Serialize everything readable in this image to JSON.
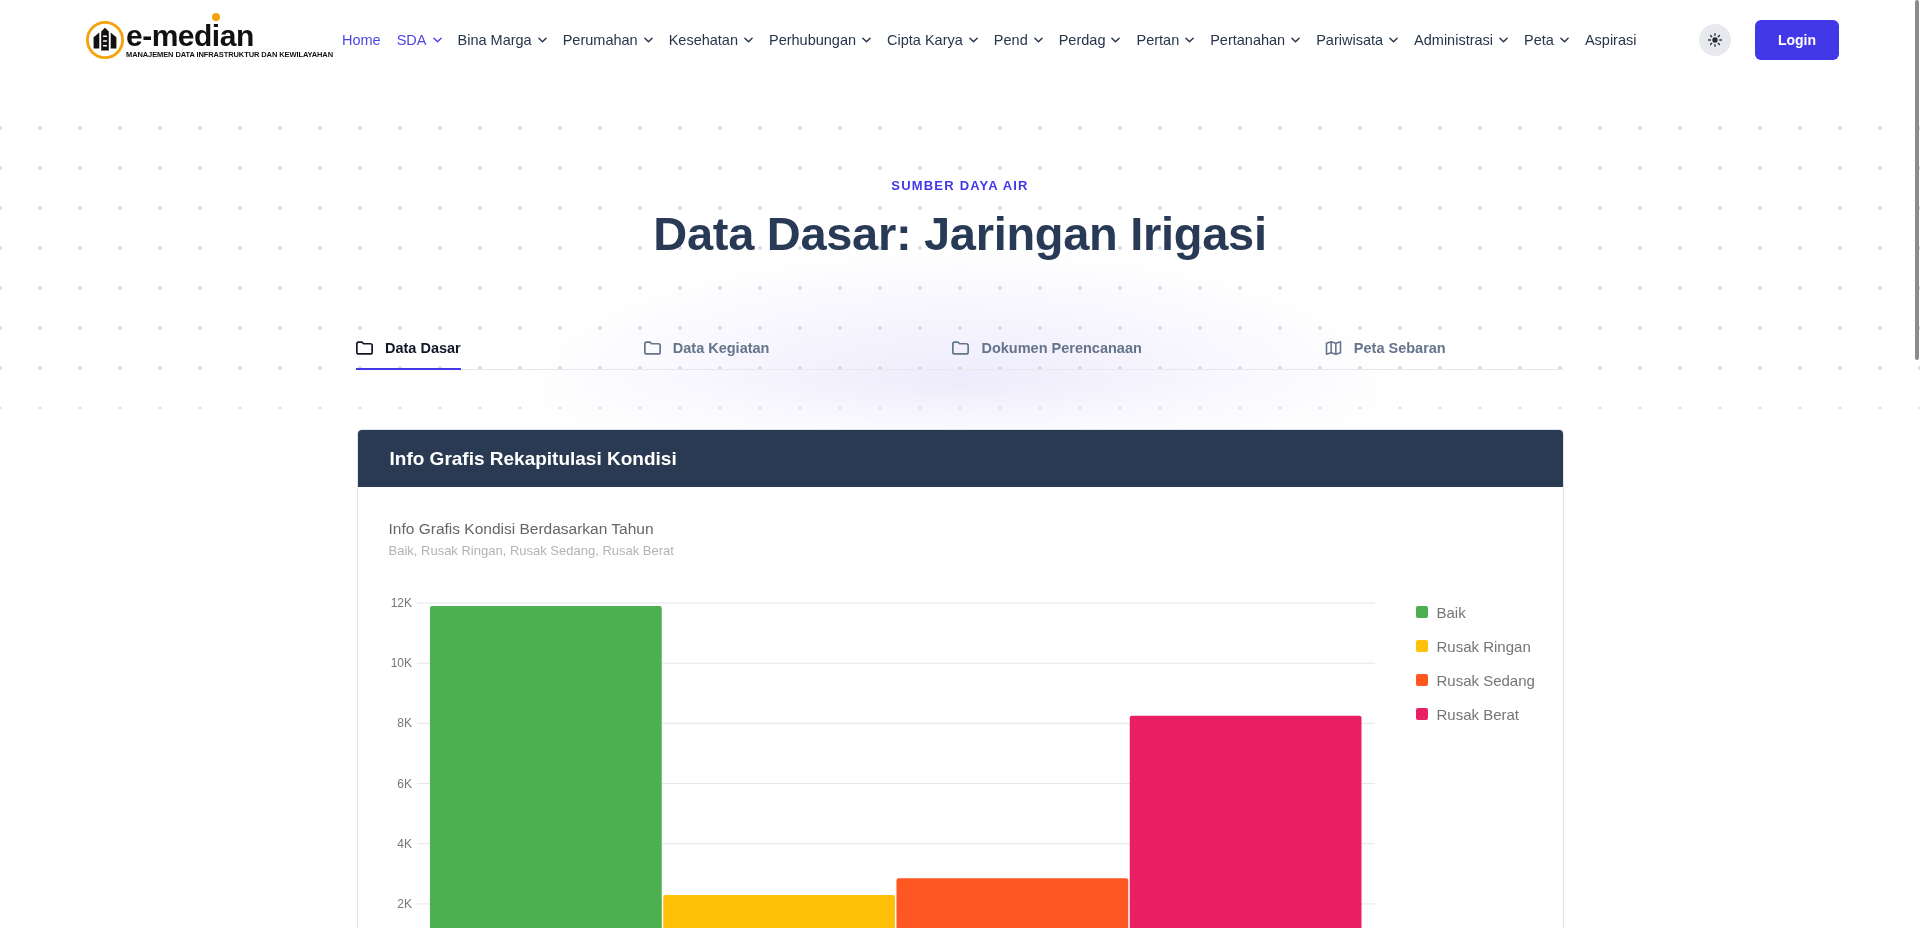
{
  "header": {
    "logo": {
      "name": "e-median",
      "tagline": "MANAJEMEN DATA INFRASTRUKTUR DAN KEWILAYAHAN"
    },
    "nav": [
      {
        "label": "Home",
        "selected": true,
        "dropdown": false
      },
      {
        "label": "SDA",
        "selected": true,
        "dropdown": true
      },
      {
        "label": "Bina Marga",
        "selected": false,
        "dropdown": true
      },
      {
        "label": "Perumahan",
        "selected": false,
        "dropdown": true
      },
      {
        "label": "Kesehatan",
        "selected": false,
        "dropdown": true
      },
      {
        "label": "Perhubungan",
        "selected": false,
        "dropdown": true
      },
      {
        "label": "Cipta Karya",
        "selected": false,
        "dropdown": true
      },
      {
        "label": "Pend",
        "selected": false,
        "dropdown": true
      },
      {
        "label": "Perdag",
        "selected": false,
        "dropdown": true
      },
      {
        "label": "Pertan",
        "selected": false,
        "dropdown": true
      },
      {
        "label": "Pertanahan",
        "selected": false,
        "dropdown": true
      },
      {
        "label": "Pariwisata",
        "selected": false,
        "dropdown": true
      },
      {
        "label": "Administrasi",
        "selected": false,
        "dropdown": true
      },
      {
        "label": "Peta",
        "selected": false,
        "dropdown": true
      },
      {
        "label": "Aspirasi",
        "selected": false,
        "dropdown": false
      }
    ],
    "login_button": "Login"
  },
  "hero": {
    "eyebrow": "SUMBER DAYA AIR",
    "title": "Data Dasar: Jaringan Irigasi"
  },
  "tabs": [
    {
      "label": "Data Dasar",
      "kind": "folder",
      "selected": true
    },
    {
      "label": "Data Kegiatan",
      "kind": "folder",
      "selected": false
    },
    {
      "label": "Dokumen Perencanaan",
      "kind": "folder",
      "selected": false
    },
    {
      "label": "Peta Sebaran",
      "kind": "map",
      "selected": false
    }
  ],
  "card": {
    "title": "Info Grafis Rekapitulasi Kondisi",
    "chart_subtitle": "Baik, Rusak Ringan, Rusak Sedang, Rusak Berat",
    "chart_data": {
      "type": "bar",
      "title": "Info Grafis Kondisi Berdasarkan Tahun",
      "series": [
        {
          "name": "Baik",
          "color": "#4caf50",
          "values": [
            11900
          ]
        },
        {
          "name": "Rusak Ringan",
          "color": "#ffc107",
          "values": [
            2300
          ]
        },
        {
          "name": "Rusak Sedang",
          "color": "#ff5722",
          "values": [
            2850
          ]
        },
        {
          "name": "Rusak Berat",
          "color": "#e91e63",
          "values": [
            8250
          ]
        }
      ],
      "ylim": [
        1200,
        12000
      ],
      "yticks": [
        {
          "value": 2000,
          "label": "2K"
        },
        {
          "value": 4000,
          "label": "4K"
        },
        {
          "value": 6000,
          "label": "6K"
        },
        {
          "value": 8000,
          "label": "8K"
        },
        {
          "value": 10000,
          "label": "10K"
        },
        {
          "value": 12000,
          "label": "12K"
        }
      ],
      "grid": true
    }
  }
}
